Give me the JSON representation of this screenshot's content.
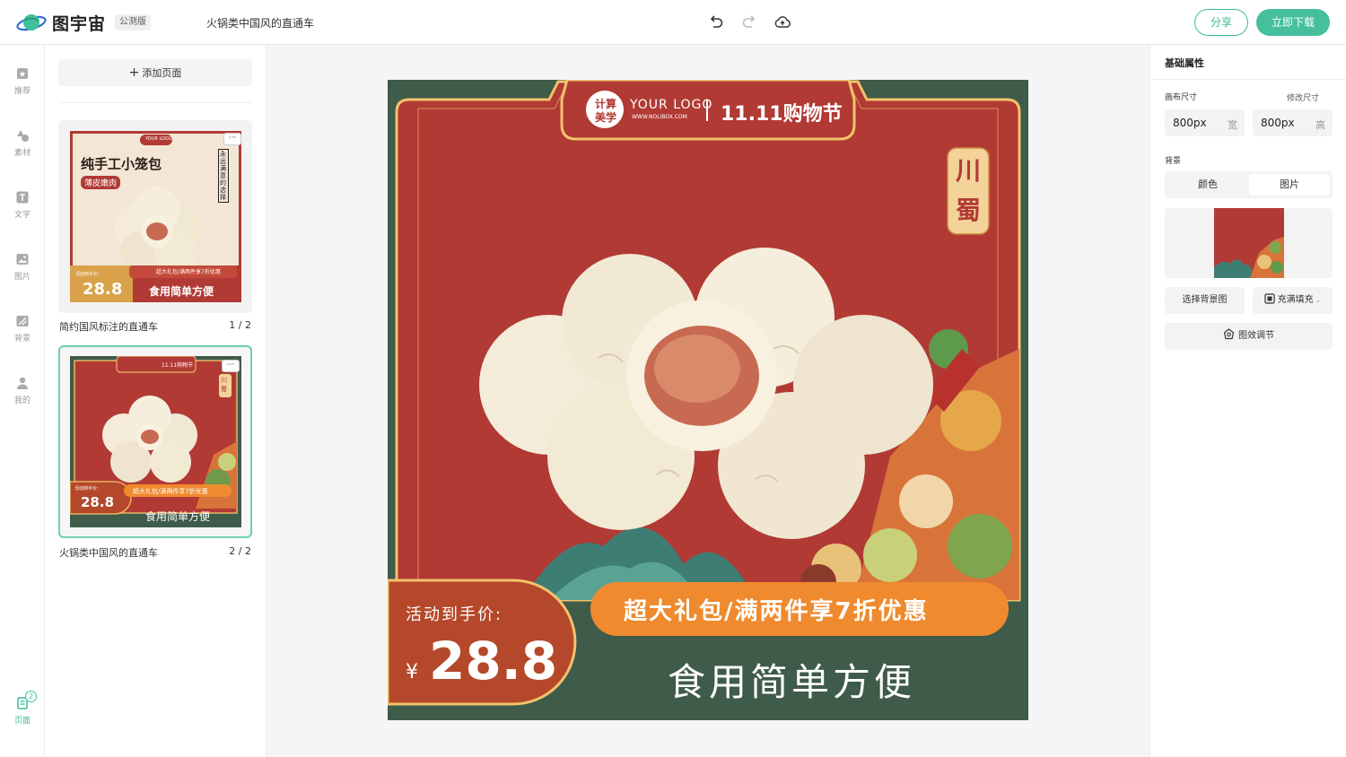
{
  "app": {
    "brand": "图宇宙",
    "beta_tag": "公测版",
    "document_title": "火锅类中国风的直通车"
  },
  "toolbar": {
    "undo_icon": "undo-icon",
    "redo_icon": "redo-icon",
    "cloud_icon": "cloud-upload-icon",
    "share_label": "分享",
    "download_label": "立即下载",
    "accent_color": "#45bf9c"
  },
  "rail": {
    "items": [
      {
        "label": "推荐",
        "icon": "recommend-icon"
      },
      {
        "label": "素材",
        "icon": "shapes-icon"
      },
      {
        "label": "文字",
        "icon": "text-icon"
      },
      {
        "label": "图片",
        "icon": "image-icon"
      },
      {
        "label": "背景",
        "icon": "background-icon"
      },
      {
        "label": "我的",
        "icon": "user-icon"
      }
    ],
    "pages": {
      "label": "页面",
      "count": "2",
      "icon": "pages-icon"
    }
  },
  "pages_panel": {
    "add_page_label": "添加页面",
    "pages": [
      {
        "caption": "简约国风标注的直通车",
        "index": "1 / 2",
        "more": "···",
        "thumb": {
          "title": "纯手工小笼包",
          "tag": "薄皮嫩肉",
          "vertical": "永远满意的选择",
          "price_label": "活动到手价:",
          "price": "28.8",
          "promo": "超大礼包/满两件享7折优惠",
          "slogan": "食用简单方便",
          "logo_text": "YOUR LOGO"
        }
      },
      {
        "caption": "火锅类中国风的直通车",
        "index": "2 / 2",
        "more": "···",
        "thumb": {
          "header": "11.11购物节",
          "badge": "川蜀",
          "price_label": "活动到手价:",
          "price": "28.8",
          "promo": "超大礼包/满两件享7折优惠",
          "slogan": "食用简单方便"
        }
      }
    ]
  },
  "canvas": {
    "logo_badge_line1": "计算",
    "logo_badge_line2": "美学",
    "logo_main": "YOUR LOGO",
    "logo_sub": "WWW.NOLIBOX.COM",
    "event": "11.11购物节",
    "badge": "川蜀",
    "price_label": "活动到手价:",
    "currency": "¥",
    "price": "28.8",
    "promo": "超大礼包/满两件享7折优惠",
    "slogan": "食用简单方便",
    "colors": {
      "red": "#b13a35",
      "green": "#3f5b4a",
      "orange": "#ef8a2e",
      "rust": "#b5482a",
      "gold": "#f2c36b"
    }
  },
  "properties": {
    "section_title": "基础属性",
    "canvas_size_label": "画布尺寸",
    "resize_label": "修改尺寸",
    "width_value": "800px",
    "width_unit": "宽",
    "height_value": "800px",
    "height_unit": "高",
    "background_label": "背景",
    "tab_color": "颜色",
    "tab_image": "图片",
    "choose_bg_label": "选择背景图",
    "fill_mode_label": "充满填充",
    "effects_label": "图效调节"
  }
}
